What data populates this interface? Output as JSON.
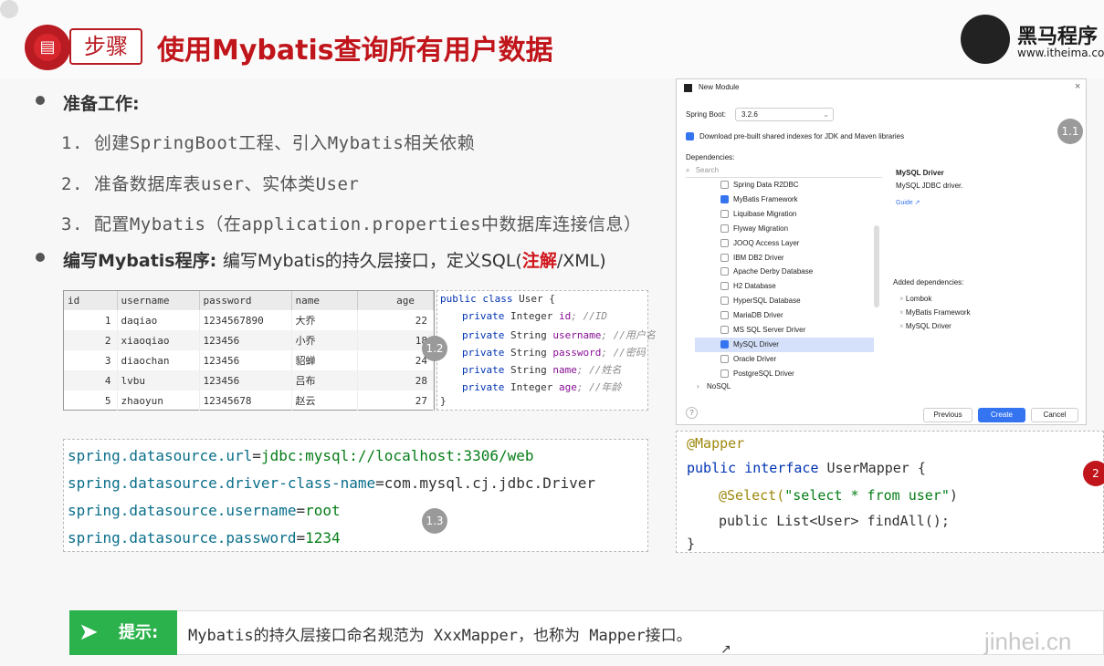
{
  "header": {
    "step_label": "步骤",
    "title": "使用Mybatis查询所有用户数据",
    "brand_name": "黑马程序",
    "brand_url": "www.itheima.co"
  },
  "bullets": {
    "prep_heading": "准备工作:",
    "prep_items": [
      "1. 创建SpringBoot工程、引入Mybatis相关依赖",
      "2. 准备数据库表user、实体类User",
      "3. 配置Mybatis（在application.properties中数据库连接信息）"
    ],
    "write_heading": "编写Mybatis程序:",
    "write_text_a": "编写Mybatis的持久层接口，定义SQL(",
    "write_text_red": "注解",
    "write_text_b": "/XML)"
  },
  "db_table": {
    "columns": [
      "id",
      "username",
      "password",
      "name",
      "age"
    ],
    "rows": [
      [
        "1",
        "daqiao",
        "1234567890",
        "大乔",
        "22"
      ],
      [
        "2",
        "xiaoqiao",
        "123456",
        "小乔",
        "18"
      ],
      [
        "3",
        "diaochan",
        "123456",
        "貂蝉",
        "24"
      ],
      [
        "4",
        "lvbu",
        "123456",
        "吕布",
        "28"
      ],
      [
        "5",
        "zhaoyun",
        "12345678",
        "赵云",
        "27"
      ]
    ]
  },
  "class_code": {
    "l1a": "public class ",
    "l1b": "User {",
    "fields": [
      {
        "mod": "private ",
        "type": "Integer ",
        "name": "id",
        "cmt": "; //ID"
      },
      {
        "mod": "private ",
        "type": "String ",
        "name": "username",
        "cmt": "; //用户名"
      },
      {
        "mod": "private ",
        "type": "String ",
        "name": "password",
        "cmt": "; //密码"
      },
      {
        "mod": "private ",
        "type": "String ",
        "name": "name",
        "cmt": "; //姓名"
      },
      {
        "mod": "private ",
        "type": "Integer ",
        "name": "age",
        "cmt": "; //年龄"
      }
    ],
    "close": "}"
  },
  "props": [
    {
      "k": "spring.datasource.url",
      "v": "jdbc:mysql://localhost:3306/web"
    },
    {
      "k": "spring.datasource.driver-class-name",
      "v": "com.mysql.cj.jdbc.Driver"
    },
    {
      "k": "spring.datasource.username",
      "v": "root"
    },
    {
      "k": "spring.datasource.password",
      "v": "1234"
    }
  ],
  "mapper": {
    "annotation": "@Mapper",
    "l2a": "public interface ",
    "l2b": "UserMapper {",
    "sel_ann": "@Select(",
    "sel_str": "\"select * from user\"",
    "sel_close": ")",
    "l4": "public List<User> findAll();",
    "close": "}"
  },
  "badges": {
    "b11": "1.1",
    "b12": "1.2",
    "b13": "1.3",
    "b2": "2"
  },
  "dialog": {
    "title": "New Module",
    "spring_boot_label": "Spring Boot:",
    "spring_boot_version": "3.2.6",
    "download_label": "Download pre-built shared indexes for JDK and Maven libraries",
    "deps_label": "Dependencies:",
    "search_placeholder": "Search",
    "deps": [
      {
        "label": "Spring Data R2DBC",
        "checked": false
      },
      {
        "label": "MyBatis Framework",
        "checked": true
      },
      {
        "label": "Liquibase Migration",
        "checked": false
      },
      {
        "label": "Flyway Migration",
        "checked": false
      },
      {
        "label": "JOOQ Access Layer",
        "checked": false
      },
      {
        "label": "IBM DB2 Driver",
        "checked": false
      },
      {
        "label": "Apache Derby Database",
        "checked": false
      },
      {
        "label": "H2 Database",
        "checked": false
      },
      {
        "label": "HyperSQL Database",
        "checked": false
      },
      {
        "label": "MariaDB Driver",
        "checked": false
      },
      {
        "label": "MS SQL Server Driver",
        "checked": false
      },
      {
        "label": "MySQL Driver",
        "checked": true
      },
      {
        "label": "Oracle Driver",
        "checked": false
      },
      {
        "label": "PostgreSQL Driver",
        "checked": false
      }
    ],
    "nosql": "NoSQL",
    "detail_title": "MySQL Driver",
    "detail_desc": "MySQL JDBC driver.",
    "guide": "Guide ↗",
    "added_label": "Added dependencies:",
    "added": [
      "Lombok",
      "MyBatis Framework",
      "MySQL Driver"
    ],
    "help": "?",
    "previous": "Previous",
    "create": "Create",
    "cancel": "Cancel"
  },
  "tip": {
    "label": "提示:",
    "text": "Mybatis的持久层接口命名规范为 XxxMapper，也称为 Mapper接口。"
  },
  "watermark": "jinhei.cn"
}
